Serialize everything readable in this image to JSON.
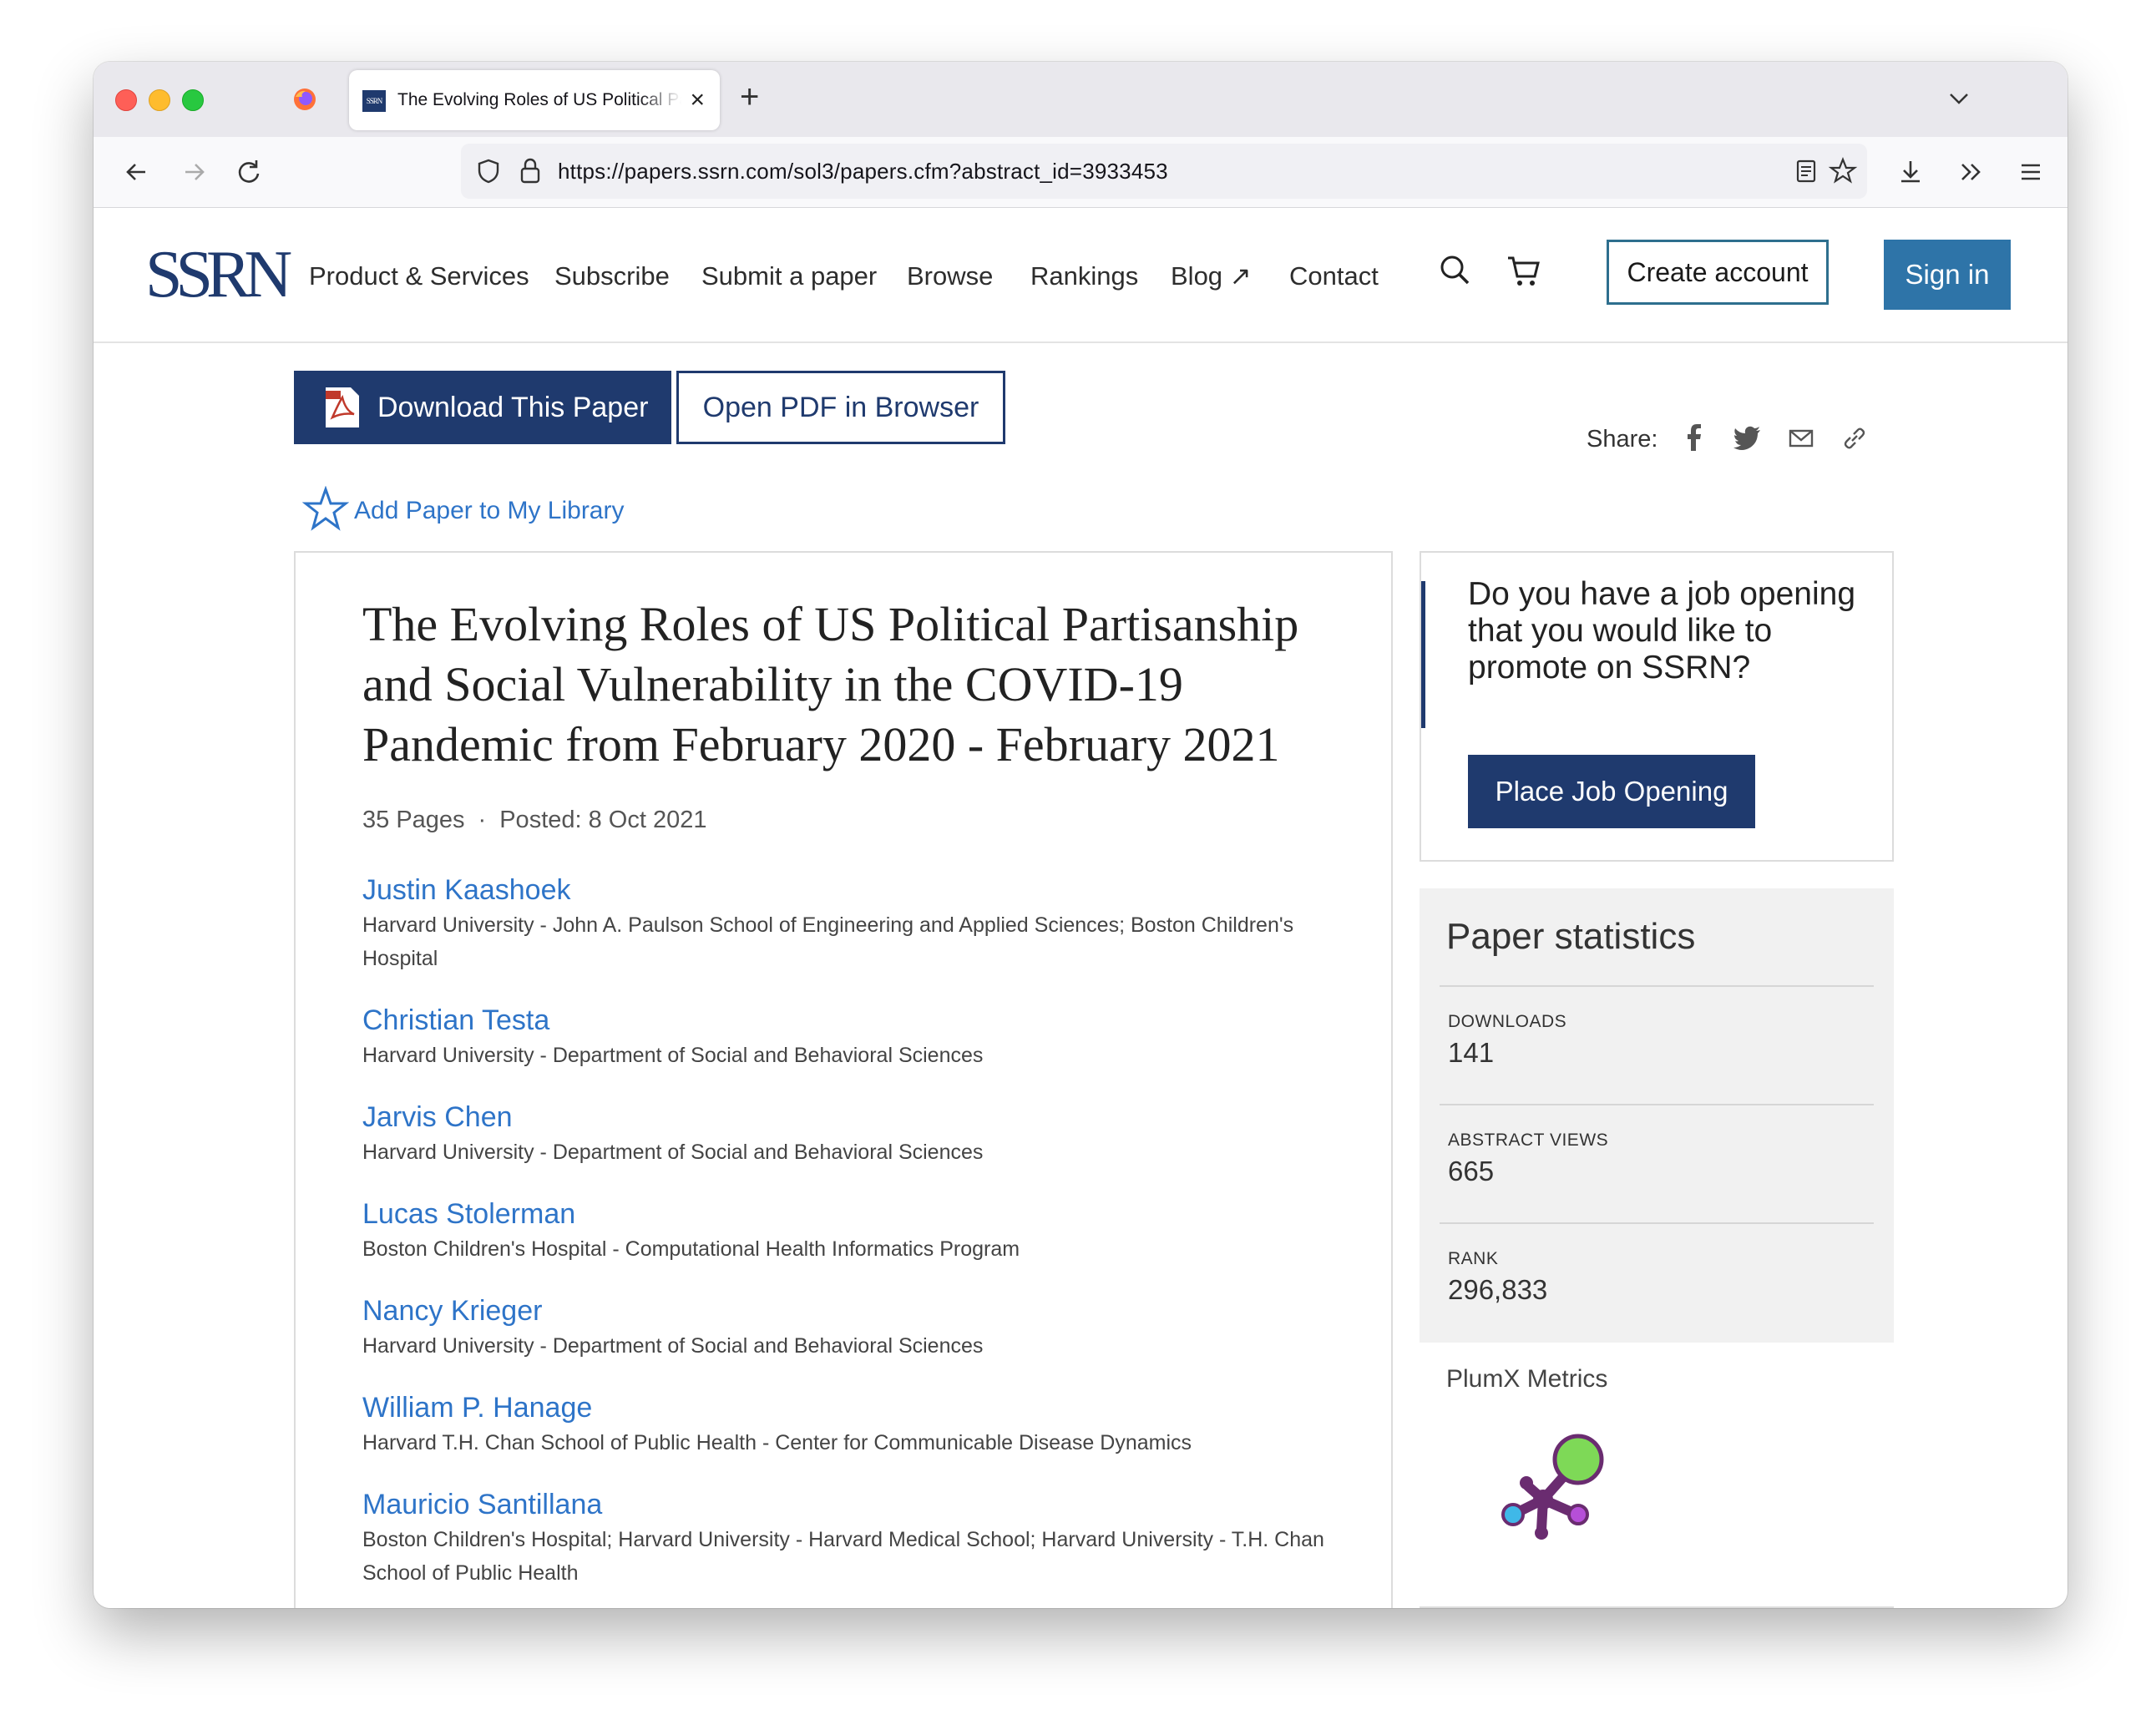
{
  "browser": {
    "tab_title": "The Evolving Roles of US Political Partisanship",
    "tab_favicon_text": "SSRN",
    "url": "https://papers.ssrn.com/sol3/papers.cfm?abstract_id=3933453"
  },
  "header": {
    "logo": "SSRN",
    "menu": [
      "Product & Services",
      "Subscribe",
      "Submit a paper",
      "Browse",
      "Rankings",
      "Blog ↗",
      "Contact"
    ],
    "create_account": "Create account",
    "sign_in": "Sign in"
  },
  "actions": {
    "download": "Download This Paper",
    "open_pdf": "Open PDF in Browser",
    "share_label": "Share:",
    "add_library": "Add Paper to My Library"
  },
  "paper": {
    "title": "The Evolving Roles of US Political Partisanship and Social Vulnerability in the COVID-19 Pandemic from February 2020 - February 2021",
    "pages": "35 Pages",
    "posted": "Posted: 8 Oct 2021",
    "authors": [
      {
        "name": "Justin Kaashoek",
        "affiliation": "Harvard University - John A. Paulson School of Engineering and Applied Sciences; Boston Children's Hospital"
      },
      {
        "name": "Christian Testa",
        "affiliation": "Harvard University - Department of Social and Behavioral Sciences"
      },
      {
        "name": "Jarvis Chen",
        "affiliation": "Harvard University - Department of Social and Behavioral Sciences"
      },
      {
        "name": "Lucas Stolerman",
        "affiliation": "Boston Children's Hospital - Computational Health Informatics Program"
      },
      {
        "name": "Nancy Krieger",
        "affiliation": "Harvard University - Department of Social and Behavioral Sciences"
      },
      {
        "name": "William P. Hanage",
        "affiliation": "Harvard T.H. Chan School of Public Health - Center for Communicable Disease Dynamics"
      },
      {
        "name": "Mauricio Santillana",
        "affiliation": "Boston Children's Hospital; Harvard University - Harvard Medical School; Harvard University - T.H. Chan School of Public Health"
      }
    ]
  },
  "sidebar": {
    "job_text": "Do you have a job opening that you would like to promote on SSRN?",
    "job_button": "Place Job Opening",
    "stats_title": "Paper statistics",
    "stats": [
      {
        "label": "DOWNLOADS",
        "value": "141"
      },
      {
        "label": "ABSTRACT VIEWS",
        "value": "665"
      },
      {
        "label": "RANK",
        "value": "296,833"
      }
    ],
    "plumx_label": "PlumX Metrics"
  },
  "colors": {
    "brand_navy": "#1f3a6e",
    "link_blue": "#2e74c8",
    "signin_blue": "#2e74a8",
    "plumx_green": "#7ed957",
    "plumx_purple": "#6a2c70",
    "plumx_blue": "#3fb8e8",
    "plumx_magenta": "#b64fd8"
  },
  "icons": {
    "share": [
      "facebook-icon",
      "twitter-icon",
      "mail-icon",
      "link-icon"
    ],
    "header": [
      "search-icon",
      "cart-icon"
    ]
  }
}
